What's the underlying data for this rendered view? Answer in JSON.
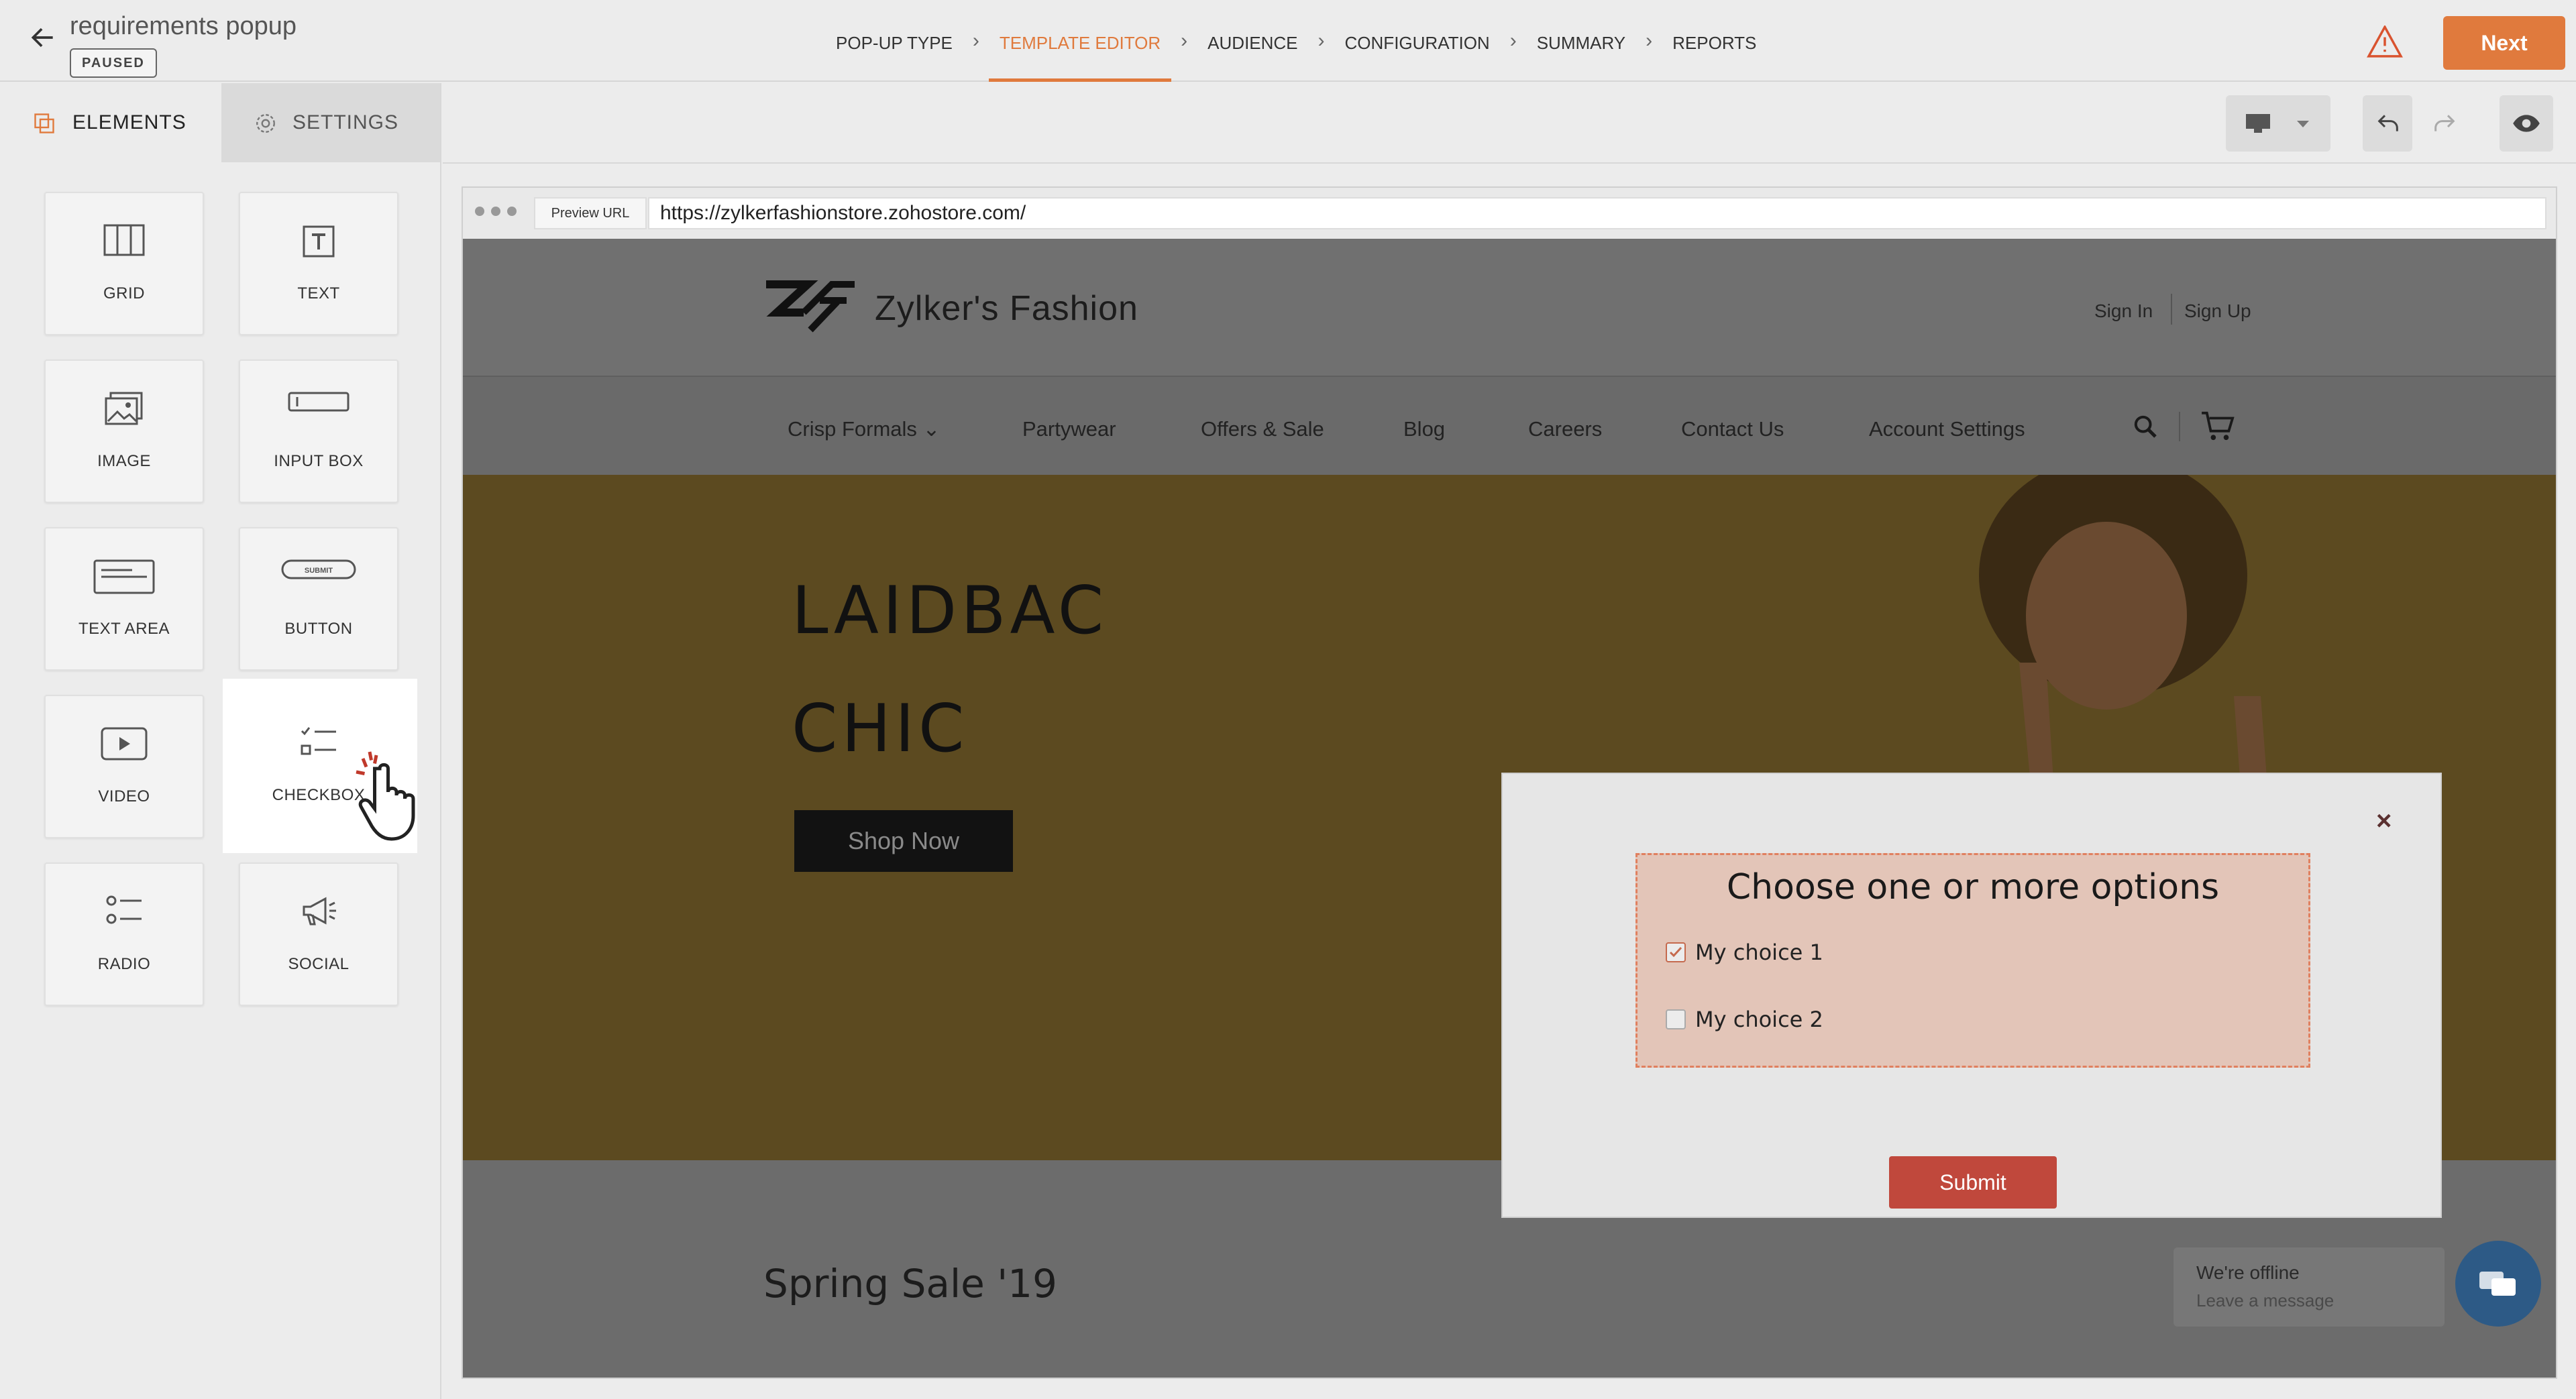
{
  "header": {
    "title": "requirements popup",
    "status": "PAUSED",
    "steps": [
      {
        "label": "POP-UP TYPE"
      },
      {
        "label": "TEMPLATE EDITOR"
      },
      {
        "label": "AUDIENCE"
      },
      {
        "label": "CONFIGURATION"
      },
      {
        "label": "SUMMARY"
      },
      {
        "label": "REPORTS"
      }
    ],
    "active_step": "TEMPLATE EDITOR",
    "next_label": "Next",
    "accent_color": "#e07a3d"
  },
  "left_panel": {
    "tabs": [
      {
        "label": "ELEMENTS"
      },
      {
        "label": "SETTINGS"
      }
    ],
    "elements": [
      {
        "label": "GRID",
        "icon": "grid-icon"
      },
      {
        "label": "TEXT",
        "icon": "text-icon"
      },
      {
        "label": "IMAGE",
        "icon": "image-icon"
      },
      {
        "label": "INPUT BOX",
        "icon": "input-box-icon"
      },
      {
        "label": "TEXT AREA",
        "icon": "text-area-icon"
      },
      {
        "label": "BUTTON",
        "icon": "button-icon",
        "icon_text": "SUBMIT"
      },
      {
        "label": "VIDEO",
        "icon": "video-icon"
      },
      {
        "label": "CHECKBOX",
        "icon": "checkbox-icon"
      },
      {
        "label": "RADIO",
        "icon": "radio-icon"
      },
      {
        "label": "SOCIAL",
        "icon": "megaphone-icon"
      }
    ]
  },
  "preview": {
    "url_label": "Preview URL",
    "url": "https://zylkerfashionstore.zohostore.com/"
  },
  "site": {
    "brand": "Zylker's Fashion",
    "sign_in": "Sign In",
    "sign_up": "Sign Up",
    "nav": [
      {
        "label": "Crisp Formals ⌄"
      },
      {
        "label": "Partywear"
      },
      {
        "label": "Offers & Sale"
      },
      {
        "label": "Blog"
      },
      {
        "label": "Careers"
      },
      {
        "label": "Contact Us"
      },
      {
        "label": "Account Settings"
      }
    ],
    "hero_line1": "LAIDBAC",
    "hero_line2": "CHIC",
    "shop_now": "Shop Now",
    "section_title": "Spring Sale '19",
    "chat_line1": "We're offline",
    "chat_line2": "Leave a message"
  },
  "popup": {
    "close": "×",
    "question": "Choose one or more options",
    "options": [
      {
        "label": "My choice 1",
        "checked": true
      },
      {
        "label": "My choice 2",
        "checked": false
      }
    ],
    "submit_label": "Submit",
    "panel_color": "#e3c5b8",
    "submit_color": "#c0483c"
  }
}
